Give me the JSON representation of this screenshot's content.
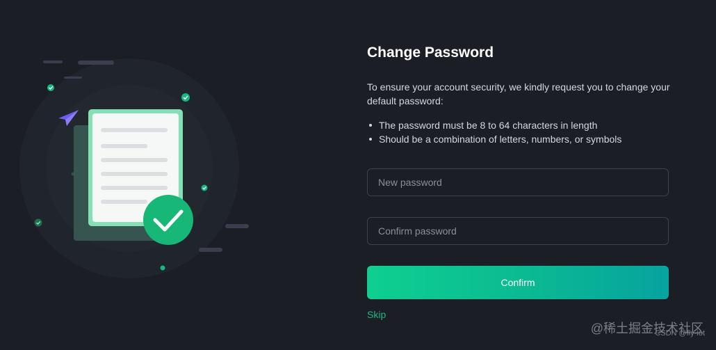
{
  "form": {
    "title": "Change Password",
    "description": "To ensure your account security, we kindly request you to change your default password:",
    "rules": [
      "The password must be 8 to 64 characters in length",
      "Should be a combination of letters, numbers, or symbols"
    ],
    "new_password_placeholder": "New password",
    "confirm_password_placeholder": "Confirm password",
    "confirm_label": "Confirm",
    "skip_label": "Skip"
  },
  "watermark": {
    "main": "@稀土掘金技术社区",
    "sub": "CSDN @fly-iot"
  },
  "colors": {
    "background": "#1b1e25",
    "accent": "#0fcf90",
    "accent_end": "#07a3a0",
    "link": "#18b98a",
    "paper_plane": "#6c5cf5"
  },
  "icons": [
    "paper-plane-icon",
    "document-icon",
    "check-circle-icon",
    "small-check-badge-icon"
  ]
}
